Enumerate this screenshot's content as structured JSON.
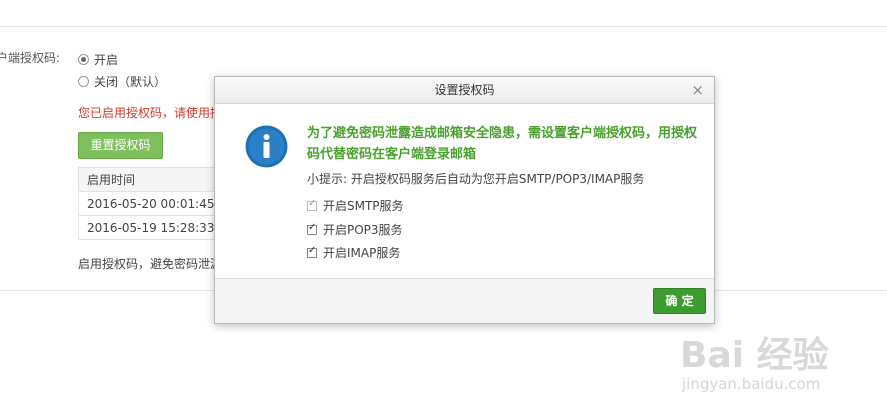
{
  "background": {
    "topbar_clip": "",
    "client_auth_label": "户端授权码:",
    "radio_on": "开启",
    "radio_off": "关闭（默认）",
    "warning_red": "您已启用授权码，请使用授",
    "reset_button": "重置授权码",
    "table": {
      "header": "启用时间",
      "rows": [
        "2016-05-20 00:01:45",
        "2016-05-19 15:28:33"
      ]
    },
    "footer_text": "启用授权码，避免密码泄漏"
  },
  "modal": {
    "title": "设置授权码",
    "close_glyph": "×",
    "warning": "为了避免密码泄露造成邮箱安全隐患，需设置客户端授权码，用授权码代替密码在客户端登录邮箱",
    "tip": "小提示: 开启授权码服务后自动为您开启SMTP/POP3/IMAP服务",
    "checks": [
      "开启SMTP服务",
      "开启POP3服务",
      "开启IMAP服务"
    ],
    "ok_button": "确 定"
  },
  "watermark": {
    "main": "Bai  经验",
    "sub": "jingyan.baidu.com"
  },
  "colors": {
    "accent_green": "#3b9d2f",
    "warning_green": "#4aa12e",
    "error_red": "#d23a2b",
    "info_blue": "#1f6fb5"
  }
}
